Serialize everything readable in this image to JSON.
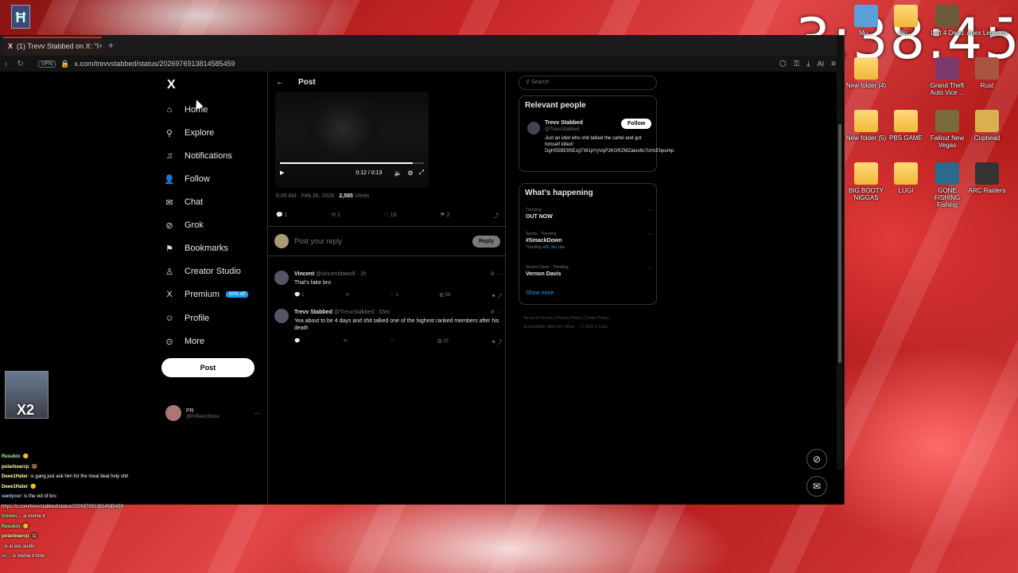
{
  "clock": "3:38:45",
  "browser": {
    "tab_title": "(1) Trevv Stabbed on X: \"I",
    "tab_close": "×",
    "new_tab": "+",
    "vpn": "VPN",
    "url": "x.com/trevvstabbed/status/2026976913814585459",
    "ai_label": "AI"
  },
  "nav": {
    "logo": "X",
    "items": [
      {
        "label": "Home",
        "icon": "home-icon",
        "glyph": "⌂"
      },
      {
        "label": "Explore",
        "icon": "search-icon",
        "glyph": "⚲"
      },
      {
        "label": "Notifications",
        "icon": "bell-icon",
        "glyph": "♫"
      },
      {
        "label": "Follow",
        "icon": "follow-icon",
        "glyph": "👤"
      },
      {
        "label": "Chat",
        "icon": "chat-icon",
        "glyph": "✉"
      },
      {
        "label": "Grok",
        "icon": "grok-icon",
        "glyph": "⊘"
      },
      {
        "label": "Bookmarks",
        "icon": "bookmark-icon",
        "glyph": "⚑"
      },
      {
        "label": "Creator Studio",
        "icon": "creator-icon",
        "glyph": "♙"
      },
      {
        "label": "Premium",
        "icon": "premium-icon",
        "glyph": "X",
        "badge": "50% off"
      },
      {
        "label": "Profile",
        "icon": "profile-icon",
        "glyph": "☺"
      },
      {
        "label": "More",
        "icon": "more-icon",
        "glyph": "⊙"
      }
    ],
    "post_button": "Post",
    "account": {
      "name": "PR",
      "handle": "@PrBeenStone",
      "menu": "···"
    }
  },
  "post": {
    "header": "Post",
    "back": "←",
    "video_time": "0:12 / 0:13",
    "video_progress": 0.92,
    "timestamp": "6:05 AM · Feb 26, 2026 · ",
    "views": "2,585",
    "views_label": " Views",
    "actions": {
      "reply": "1",
      "repost": "1",
      "like": "16",
      "bookmark": "2"
    },
    "reply_placeholder": "Post your reply",
    "reply_button": "Reply"
  },
  "comments": [
    {
      "name": "Vincent",
      "handle": "@vincentdawolf · 1h",
      "text": "That's fake bro",
      "reply": "1",
      "repost": "",
      "like": "1",
      "views": "58"
    },
    {
      "name": "Trevv Stabbed",
      "handle": "@TrevvStabbed · 55m",
      "text": "Yea about to be 4 days and shit talked one of the highest ranked members after his death",
      "reply": "",
      "repost": "",
      "like": "",
      "views": "25"
    }
  ],
  "sidebar": {
    "search_placeholder": "Search",
    "relevant_title": "Relevant people",
    "person": {
      "name": "Trevv Stabbed",
      "handle": "@TrevvStabbed",
      "follow": "Follow",
      "bio": "Just an idiot who shit talked the cartel and got himself killed! DgHS5BE9SEzgTW1pYyVqP2KGRZMZatuv8c7oHzEhpump"
    },
    "happening_title": "What's happening",
    "trends": [
      {
        "label": "Trending",
        "title": "OUT NOW",
        "sub": ""
      },
      {
        "label": "Sports · Trending",
        "title": "#SmackDown",
        "sub_prefix": "Trending with ",
        "sub_link": "Jey Uso"
      },
      {
        "label": "Vernon Davis · Trending",
        "title": "Vernon Davis",
        "sub": ""
      }
    ],
    "show_more": "Show more",
    "footer1": "Terms of Service  |  Privacy Policy  |  Cookie Policy  |",
    "footer2": "Accessibility  |  Ads info  |  More ···  © 2026 X Corp."
  },
  "desktop": [
    {
      "label": "Mu...",
      "kind": "app",
      "color": "#5aa0d8"
    },
    {
      "label": "Do...",
      "kind": "folder"
    },
    {
      "label": "Left 4 Dead",
      "kind": "app",
      "color": "#6a5a3a"
    },
    {
      "label": "Apex Legends",
      "kind": "app",
      "color": "#c43030"
    },
    {
      "label": "New folder (4)",
      "kind": "folder"
    },
    {
      "label": "Grand Theft Auto Vice ...",
      "kind": "app",
      "color": "#7a3a6a"
    },
    {
      "label": "Rust",
      "kind": "app",
      "color": "#a54"
    },
    {
      "label": "New folder (5)",
      "kind": "folder"
    },
    {
      "label": "PBS GAME",
      "kind": "folder"
    },
    {
      "label": "Fallout New Vegas",
      "kind": "app",
      "color": "#7a6a3a"
    },
    {
      "label": "Cuphead",
      "kind": "app",
      "color": "#d8b050"
    },
    {
      "label": "BIG BOOTY NIGGAS",
      "kind": "folder"
    },
    {
      "label": "LUGI",
      "kind": "folder"
    },
    {
      "label": "GONE FISHING Fishing",
      "kind": "app",
      "color": "#2a6a8a"
    },
    {
      "label": "ARC Raiders",
      "kind": "app",
      "color": "#333"
    }
  ],
  "overlay": {
    "cam_label": "X2",
    "chat": [
      {
        "user": "Resukio",
        "msg": ": 🙂"
      },
      {
        "user": "polarbearcp",
        "msg": ": 🐻"
      },
      {
        "user": "Deee1Hater",
        "msg": ": is gang just ask him for the meal deal holy shit"
      },
      {
        "user": "Deee1Hater",
        "msg": ": 🙂"
      },
      {
        "user": "vanlycur",
        "msg": ": is the vid of bro"
      },
      {
        "user": "",
        "msg": "https://x.com/trevvstabbed/status/2026976913814585459"
      },
      {
        "user": "Gnomi...",
        "msg": ": is meme it"
      },
      {
        "user": "Resukio",
        "msg": ": 🙂"
      },
      {
        "user": "polarbearcp",
        "msg": ": 🐻"
      },
      {
        "user": "",
        "msg": ": is ai ass audio"
      },
      {
        "user": "vr...",
        "msg": ": is meme it time"
      }
    ]
  }
}
